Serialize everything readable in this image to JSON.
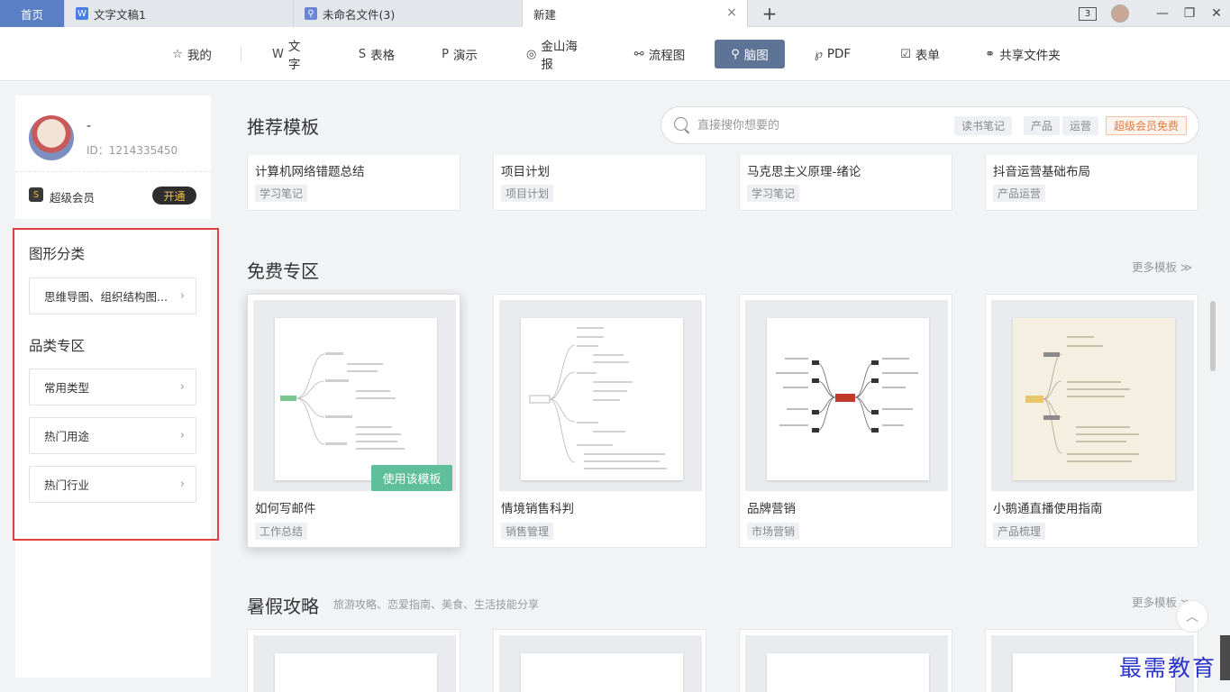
{
  "tabs": {
    "home": "首页",
    "doc": "文字文稿1",
    "mindmap_file": "未命名文件(3)",
    "new": "新建",
    "doc_icon": "W",
    "new_tab_icon": "+",
    "close_icon": "×",
    "window_count": "3"
  },
  "nav": {
    "items": [
      {
        "label": "我的",
        "icon": "star-icon",
        "glyph": "☆"
      },
      {
        "label": "文字",
        "icon": "w-icon",
        "glyph": "W"
      },
      {
        "label": "表格",
        "icon": "s-icon",
        "glyph": "S"
      },
      {
        "label": "演示",
        "icon": "p-icon",
        "glyph": "P"
      },
      {
        "label": "金山海报",
        "icon": "poster-icon",
        "glyph": "◎"
      },
      {
        "label": "流程图",
        "icon": "flowchart-icon",
        "glyph": "⚯"
      },
      {
        "label": "脑图",
        "icon": "mindmap-icon",
        "glyph": "⚲"
      },
      {
        "label": "PDF",
        "icon": "pdf-icon",
        "glyph": "℘"
      },
      {
        "label": "表单",
        "icon": "form-icon",
        "glyph": "☑"
      },
      {
        "label": "共享文件夹",
        "icon": "share-folder-icon",
        "glyph": "⚭"
      }
    ],
    "active": "脑图"
  },
  "profile": {
    "name": "-",
    "id": "ID：1214335450",
    "vip_label": "超级会员",
    "vip_button": "开通",
    "vip_icon_glyph": "S"
  },
  "filters": {
    "shape_title": "图形分类",
    "shape_item": "思维导图、组织结构图...",
    "category_title": "品类专区",
    "category_items": [
      "常用类型",
      "热门用途",
      "热门行业"
    ],
    "chevron": "›"
  },
  "recommended": {
    "title": "推荐模板",
    "search_placeholder": "直接搜你想要的",
    "tags": [
      "读书笔记",
      "产品",
      "运营"
    ],
    "vip_tag": "超级会员免费",
    "cards": [
      {
        "title": "计算机网络错题总结",
        "tag": "学习笔记"
      },
      {
        "title": "项目计划",
        "tag": "项目计划"
      },
      {
        "title": "马克思主义原理-绪论",
        "tag": "学习笔记"
      },
      {
        "title": "抖音运营基础布局",
        "tag": "产品运营"
      }
    ]
  },
  "free": {
    "title": "免费专区",
    "more": "更多模板 ≫",
    "use_button": "使用该模板",
    "cards": [
      {
        "title": "如何写邮件",
        "tag": "工作总结"
      },
      {
        "title": "情境销售科判",
        "tag": "销售管理"
      },
      {
        "title": "品牌营销",
        "tag": "市场营销"
      },
      {
        "title": "小鹅通直播使用指南",
        "tag": "产品梳理"
      }
    ]
  },
  "summer": {
    "title": "暑假攻略",
    "subtitle": "旅游攻略、恋爱指南、美食、生活技能分享",
    "more": "更多模板 ≫"
  },
  "watermark": "最需教育",
  "colors": {
    "accent_nav": "#5e7497",
    "use_button": "#5fbf9a",
    "highlight_box": "#e04040",
    "vip": "#e57a3d"
  }
}
